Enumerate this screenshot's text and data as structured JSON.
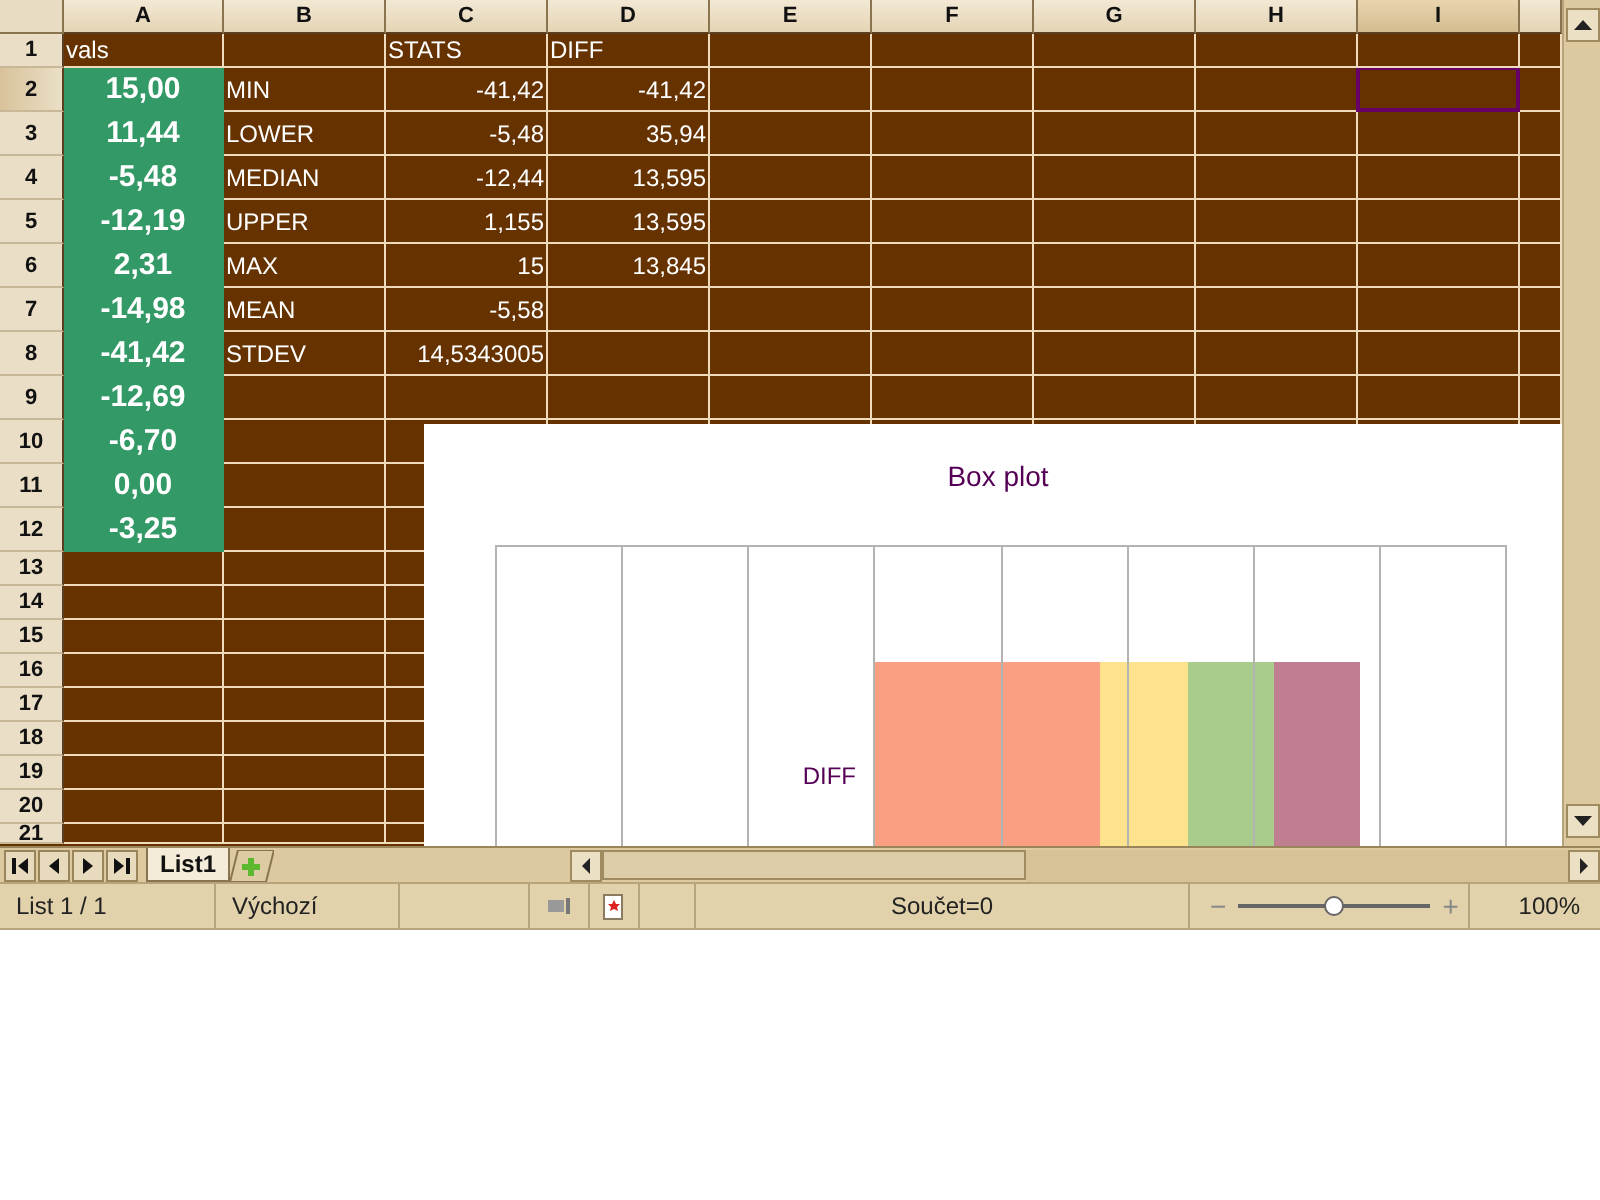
{
  "columns": [
    {
      "label": "A",
      "selected": false
    },
    {
      "label": "B",
      "selected": false
    },
    {
      "label": "C",
      "selected": false
    },
    {
      "label": "D",
      "selected": false
    },
    {
      "label": "E",
      "selected": false
    },
    {
      "label": "F",
      "selected": false
    },
    {
      "label": "G",
      "selected": false
    },
    {
      "label": "H",
      "selected": false
    },
    {
      "label": "I",
      "selected": true
    }
  ],
  "rows": [
    {
      "number": "1",
      "selected": false,
      "cells": {
        "a": {
          "text": "vals",
          "kind": "text",
          "highlighted": false
        },
        "c": {
          "text": "STATS",
          "kind": "text",
          "highlighted": false
        },
        "d": {
          "text": "DIFF",
          "kind": "text",
          "highlighted": false
        }
      }
    },
    {
      "number": "2",
      "selected": true,
      "cells": {
        "a": {
          "text": "15,00",
          "highlighted": true
        },
        "b": {
          "text": "MIN",
          "kind": "text",
          "highlighted": false
        },
        "c": {
          "text": "-41,42",
          "kind": "number",
          "highlighted": false
        },
        "d": {
          "text": "-41,42",
          "kind": "number",
          "highlighted": false
        }
      }
    },
    {
      "number": "3",
      "selected": false,
      "cells": {
        "a": {
          "text": "11,44",
          "highlighted": true
        },
        "b": {
          "text": "LOWER",
          "kind": "text",
          "highlighted": false
        },
        "c": {
          "text": "-5,48",
          "kind": "number",
          "highlighted": false
        },
        "d": {
          "text": "35,94",
          "kind": "number",
          "highlighted": false
        }
      }
    },
    {
      "number": "4",
      "selected": false,
      "cells": {
        "a": {
          "text": "-5,48",
          "highlighted": true
        },
        "b": {
          "text": "MEDIAN",
          "kind": "text",
          "highlighted": false
        },
        "c": {
          "text": "-12,44",
          "kind": "number",
          "highlighted": false
        },
        "d": {
          "text": "13,595",
          "kind": "number",
          "highlighted": false
        }
      }
    },
    {
      "number": "5",
      "selected": false,
      "cells": {
        "a": {
          "text": "-12,19",
          "highlighted": true
        },
        "b": {
          "text": "UPPER",
          "kind": "text",
          "highlighted": false
        },
        "c": {
          "text": "1,155",
          "kind": "number",
          "highlighted": false
        },
        "d": {
          "text": "13,595",
          "kind": "number",
          "highlighted": false
        }
      }
    },
    {
      "number": "6",
      "selected": false,
      "cells": {
        "a": {
          "text": "2,31",
          "highlighted": true
        },
        "b": {
          "text": "MAX",
          "kind": "text",
          "highlighted": false
        },
        "c": {
          "text": "15",
          "kind": "number",
          "highlighted": false
        },
        "d": {
          "text": "13,845",
          "kind": "number",
          "highlighted": false
        }
      }
    },
    {
      "number": "7",
      "selected": false,
      "cells": {
        "a": {
          "text": "-14,98",
          "highlighted": true
        },
        "b": {
          "text": "MEAN",
          "kind": "text",
          "highlighted": false
        },
        "c": {
          "text": "-5,58",
          "kind": "number",
          "highlighted": false
        }
      }
    },
    {
      "number": "8",
      "selected": false,
      "cells": {
        "a": {
          "text": "-41,42",
          "highlighted": true
        },
        "b": {
          "text": "STDEV",
          "kind": "text",
          "highlighted": false
        },
        "c": {
          "text": "14,5343005",
          "kind": "number",
          "highlighted": false
        }
      }
    },
    {
      "number": "9",
      "selected": false,
      "cells": {
        "a": {
          "text": "-12,69",
          "highlighted": true
        }
      }
    },
    {
      "number": "10",
      "selected": false,
      "cells": {
        "a": {
          "text": "-6,70",
          "highlighted": true
        }
      }
    },
    {
      "number": "11",
      "selected": false,
      "cells": {
        "a": {
          "text": "0,00",
          "highlighted": true
        }
      }
    },
    {
      "number": "12",
      "selected": false,
      "cells": {
        "a": {
          "text": "-3,25",
          "highlighted": true
        }
      }
    },
    {
      "number": "13",
      "selected": false
    },
    {
      "number": "14",
      "selected": false
    },
    {
      "number": "15",
      "selected": false
    },
    {
      "number": "16",
      "selected": false
    },
    {
      "number": "17",
      "selected": false
    },
    {
      "number": "18",
      "selected": false
    },
    {
      "number": "19",
      "selected": false
    },
    {
      "number": "20",
      "selected": false
    },
    {
      "number": "21",
      "selected": false
    }
  ],
  "chart": {
    "title": "Box plot",
    "category": "DIFF"
  },
  "sheet_tabs": [
    {
      "label": "List1",
      "selected": true
    }
  ],
  "status_bar": {
    "sheet": "List 1 / 1",
    "style": "Výchozí",
    "sum": "Součet=0",
    "zoom": {
      "minus": "−",
      "plus": "+",
      "level": 0.5,
      "reading": "100%"
    }
  }
}
